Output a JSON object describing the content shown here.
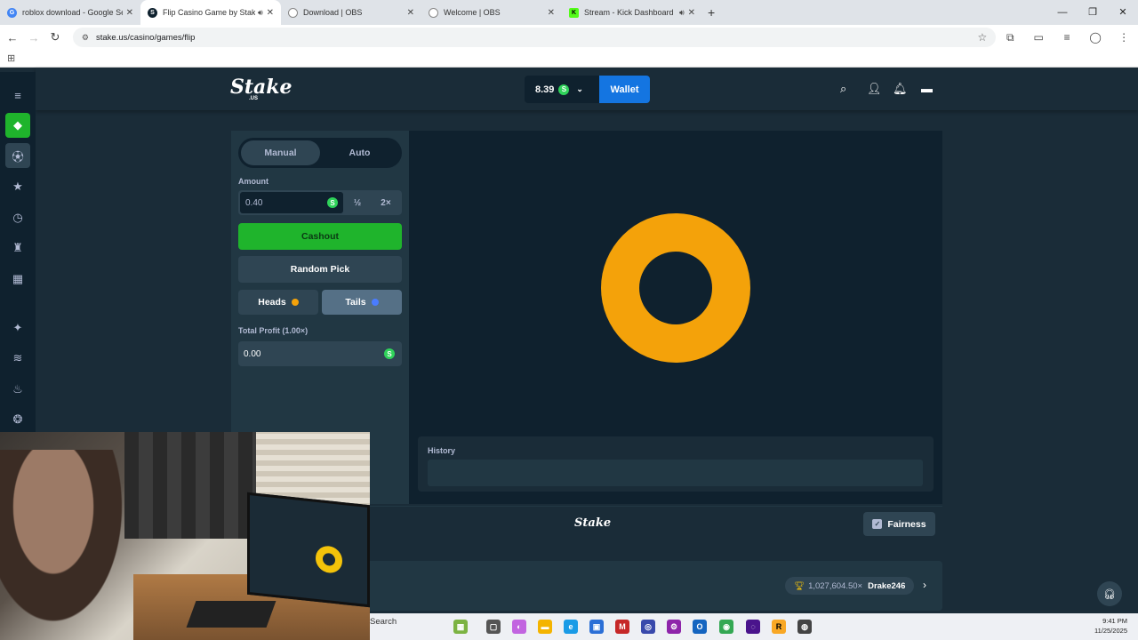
{
  "browser": {
    "tabs": [
      {
        "title": "roblox download - Google Sea",
        "favicon": "google-icon",
        "audio": false
      },
      {
        "title": "Flip Casino Game by Stake",
        "favicon": "stake-icon",
        "audio": true,
        "active": true
      },
      {
        "title": "Download | OBS",
        "favicon": "obs-icon",
        "audio": false
      },
      {
        "title": "Welcome | OBS",
        "favicon": "obs-icon",
        "audio": false
      },
      {
        "title": "Stream - Kick Dashboard",
        "favicon": "kick-icon",
        "audio": true
      }
    ],
    "url": "stake.us/casino/games/flip"
  },
  "header": {
    "logo": "Stake",
    "logo_sub": ".US",
    "balance": "8.39",
    "currency_symbol": "S",
    "wallet_label": "Wallet"
  },
  "sidebar": {
    "modes": [
      "Manual",
      "Auto"
    ],
    "active_mode": "Manual",
    "amount_label": "Amount",
    "amount_value": "0.40",
    "half_label": "½",
    "double_label": "2×",
    "cashout_label": "Cashout",
    "random_label": "Random Pick",
    "heads_label": "Heads",
    "tails_label": "Tails",
    "profit_label": "Total Profit (1.00×)",
    "profit_value": "0.00"
  },
  "game": {
    "coin_color": "#f4a20a",
    "history_label": "History"
  },
  "footer": {
    "logo": "Stake",
    "fairness_label": "Fairness",
    "big_win_multiplier": "1,027,604.50×",
    "big_win_user": "Drake246"
  },
  "taskbar": {
    "search_label": "Search",
    "time": "9:41 PM",
    "date": "11/25/2025"
  },
  "colors": {
    "accent_blue": "#1475e1",
    "cashout_green": "#1fb42c",
    "heads_dot": "#f4a20a",
    "tails_dot": "#4a7cff"
  }
}
